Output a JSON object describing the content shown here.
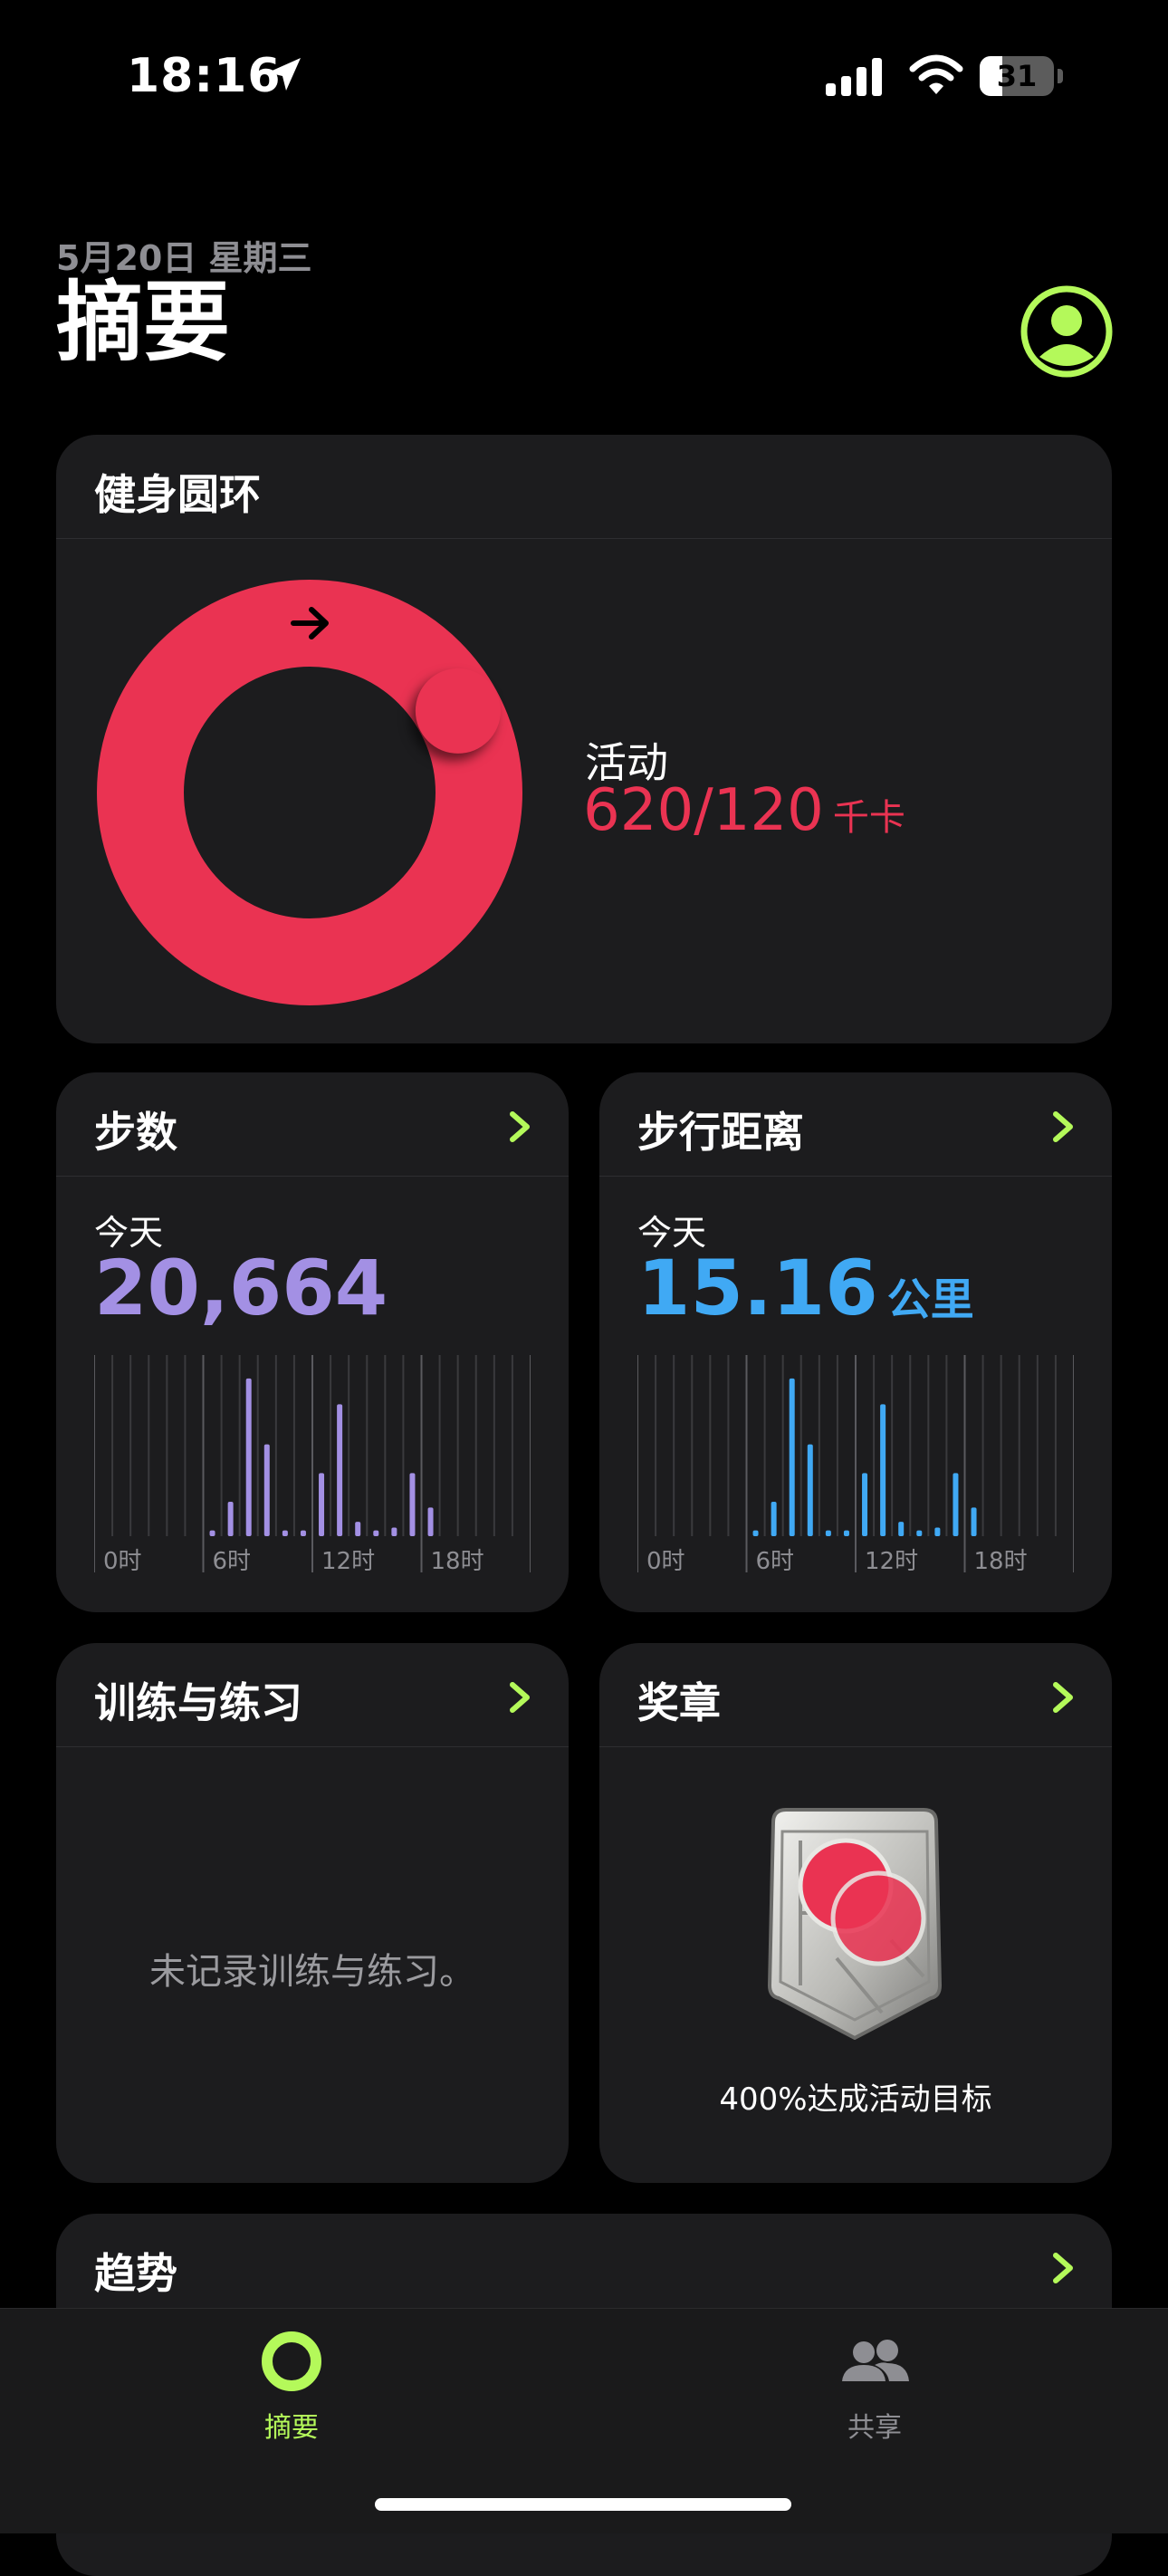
{
  "status_bar": {
    "time": "18:16",
    "battery": "31",
    "battery_level": 0.31
  },
  "header": {
    "date": "5月20日 星期三",
    "title": "摘要"
  },
  "fitness_rings": {
    "title": "健身圆环",
    "activity_label": "活动",
    "activity_value": "620/120",
    "activity_unit": "千卡",
    "progress": 5.17,
    "color": "#ea3352"
  },
  "steps": {
    "title": "步数",
    "today_label": "今天",
    "value": "20,664",
    "color": "#a390e4",
    "chart_ticks": [
      "0时",
      "6时",
      "12时",
      "18时"
    ],
    "chart_data": {
      "type": "bar",
      "x": [
        6,
        7,
        8,
        9,
        10,
        11,
        12,
        13,
        14,
        15,
        16,
        17,
        18,
        19
      ],
      "values": [
        2,
        12,
        55,
        32,
        2,
        2,
        22,
        46,
        5,
        2,
        3,
        22,
        10,
        0
      ]
    }
  },
  "distance": {
    "title": "步行距离",
    "today_label": "今天",
    "value": "15.16",
    "unit": "公里",
    "color": "#40a9f4",
    "chart_ticks": [
      "0时",
      "6时",
      "12时",
      "18时"
    ],
    "chart_data": {
      "type": "bar",
      "x": [
        6,
        7,
        8,
        9,
        10,
        11,
        12,
        13,
        14,
        15,
        16,
        17,
        18,
        19
      ],
      "values": [
        2,
        12,
        55,
        32,
        2,
        2,
        22,
        46,
        5,
        2,
        3,
        22,
        10,
        0
      ]
    }
  },
  "workouts": {
    "title": "训练与练习",
    "empty_text": "未记录训练与练习。"
  },
  "awards": {
    "title": "奖章",
    "text": "400%达成活动目标"
  },
  "trends": {
    "title": "趋势"
  },
  "tabbar": {
    "summary": "摘要",
    "sharing": "共享",
    "active_color": "#b4f95a",
    "inactive_color": "#8e8e93"
  },
  "accent": "#b4f95a"
}
